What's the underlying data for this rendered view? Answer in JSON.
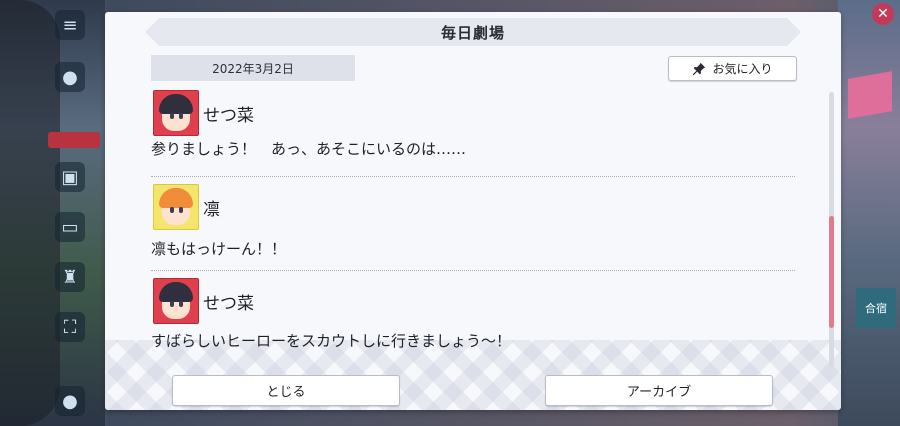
{
  "dialog": {
    "title": "毎日劇場",
    "date": "2022年3月2日",
    "favorite_label": "お気に入り",
    "messages": [
      {
        "speaker": "せつ菜",
        "text": "参りましょう！　あっ、あそこにいるのは……"
      },
      {
        "speaker": "凛",
        "text": "凛もはっけーん！！"
      },
      {
        "speaker": "せつ菜",
        "text": "すばらしいヒーローをスカウトしに行きましょう〜！"
      }
    ],
    "close_label": "とじる",
    "archive_label": "アーカイブ",
    "scroll_position": 0.7
  },
  "background": {
    "right_sign_text": "合宿"
  },
  "colors": {
    "accent": "#e37b8c",
    "title_bg": "#e6e8ef",
    "avatar_red": "#e0404d",
    "avatar_yellow": "#f4e56c"
  },
  "icons": {
    "favorite": "pin-icon",
    "close": "close-icon",
    "menu": "hamburger-menu-icon"
  }
}
